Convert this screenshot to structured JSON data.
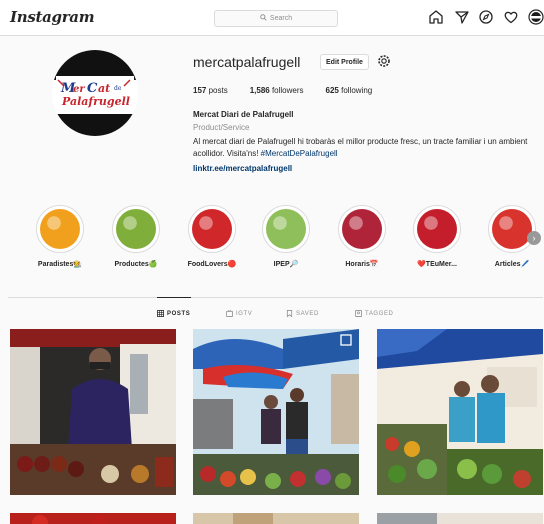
{
  "header": {
    "logo": "Instagram",
    "search_placeholder": "Search",
    "nav_icons": [
      "home-icon",
      "direct-icon",
      "explore-icon",
      "activity-heart-icon",
      "profile-avatar-icon"
    ]
  },
  "profile": {
    "username": "mercatpalafrugell",
    "edit_label": "Edit Profile",
    "avatar_text": "MerCat de Palafrugell",
    "posts_count": "157",
    "posts_label": " posts",
    "followers_count": "1,586",
    "followers_label": " followers",
    "following_count": "625",
    "following_label": " following",
    "full_name": "Mercat Diari de Palafrugell",
    "category": "Product/Service",
    "bio": "Al mercat diari de Palafrugell hi trobaràs el millor producte fresc, un tracte familiar i un ambient acollidor. Visita'ns! ",
    "bio_hashtag": "#MercatDePalafrugell",
    "link": "linktr.ee/mercatpalafrugell"
  },
  "highlights": [
    {
      "label": "Paradistes🧑‍🌾",
      "color": "#f1a01e"
    },
    {
      "label": "Productes🍏",
      "color": "#7fae3a"
    },
    {
      "label": "FoodLovers🔴",
      "color": "#d0272a"
    },
    {
      "label": "IPEP🔎",
      "color": "#8fbf5a"
    },
    {
      "label": "Horaris📅",
      "color": "#b0243a"
    },
    {
      "label": "❤️TEuMer...",
      "color": "#c41e2c"
    },
    {
      "label": "Articles🖊️",
      "color": "#d9332d"
    }
  ],
  "tabs": [
    {
      "label": "POSTS",
      "icon": "grid-icon",
      "active": true
    },
    {
      "label": "IGTV",
      "icon": "igtv-icon",
      "active": false
    },
    {
      "label": "SAVED",
      "icon": "bookmark-icon",
      "active": false
    },
    {
      "label": "TAGGED",
      "icon": "tagged-icon",
      "active": false
    }
  ],
  "colors": {
    "link": "#00376b",
    "muted": "#8e8e8e",
    "border": "#dbdbdb"
  }
}
